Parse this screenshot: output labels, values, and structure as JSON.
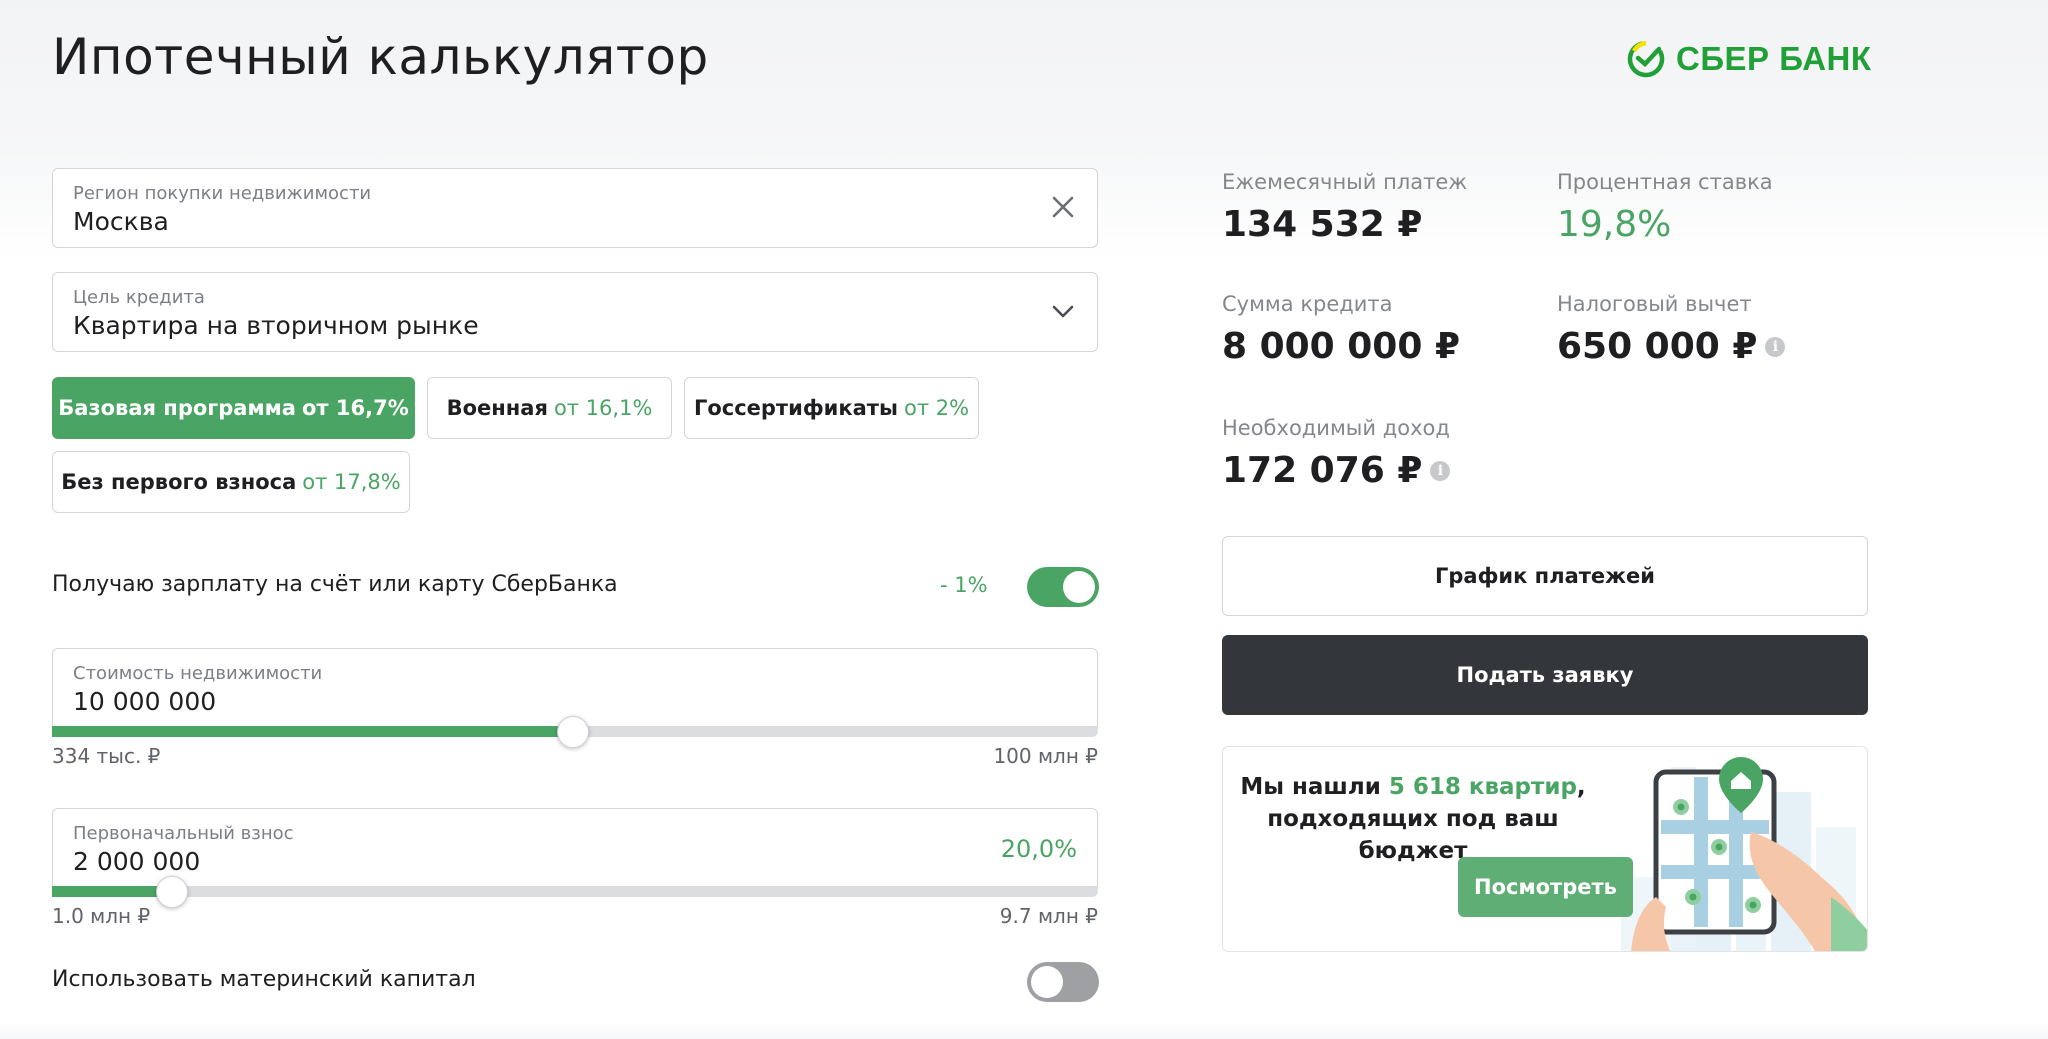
{
  "page": {
    "title": "Ипотечный калькулятор"
  },
  "brand": {
    "name": "СБЕР БАНК",
    "color": "#21a038"
  },
  "region": {
    "label": "Регион покупки недвижимости",
    "value": "Москва",
    "icon": "close-icon"
  },
  "purpose": {
    "label": "Цель кредита",
    "value": "Квартира на вторичном рынке",
    "icon": "chevron-down-icon"
  },
  "programs": [
    {
      "name": "Базовая программа",
      "rate": "от 16,7%",
      "active": true
    },
    {
      "name": "Военная",
      "rate": "от 16,1%",
      "active": false
    },
    {
      "name": "Госсертификаты",
      "rate": "от 2%",
      "active": false
    },
    {
      "name": "Без первого взноса",
      "rate": "от 17,8%",
      "active": false
    }
  ],
  "salary": {
    "label": "Получаю зарплату на счёт или карту СберБанка",
    "discount": "- 1%",
    "enabled": true
  },
  "property_cost": {
    "label": "Стоимость недвижимости",
    "value": "10 000 000",
    "min_label": "334 тыс. ₽",
    "max_label": "100 млн ₽",
    "slider_fraction": 0.497
  },
  "down_payment": {
    "label": "Первоначальный взнос",
    "value": "2 000 000",
    "percent": "20,0%",
    "min_label": "1.0 млн ₽",
    "max_label": "9.7 млн ₽",
    "slider_fraction": 0.114
  },
  "maternity_capital": {
    "label": "Использовать материнский капитал",
    "enabled": false
  },
  "results": {
    "monthly_payment": {
      "label": "Ежемесячный платеж",
      "value": "134 532 ₽"
    },
    "interest_rate": {
      "label": "Процентная ставка",
      "value": "19,8%"
    },
    "loan_amount": {
      "label": "Сумма кредита",
      "value": "8 000 000 ₽"
    },
    "tax_deduction": {
      "label": "Налоговый вычет",
      "value": "650 000 ₽"
    },
    "required_income": {
      "label": "Необходимый доход",
      "value": "172 076 ₽"
    }
  },
  "buttons": {
    "schedule": "График платежей",
    "apply": "Подать заявку"
  },
  "promo": {
    "text_before": "Мы нашли ",
    "highlight": "5 618 квартир",
    "text_after": ",",
    "line2": "подходящих под ваш бюджет",
    "button": "Посмотреть"
  },
  "colors": {
    "accent": "#4aa564",
    "dark_button": "#33363a",
    "toggle_off": "#9ea0a4"
  }
}
